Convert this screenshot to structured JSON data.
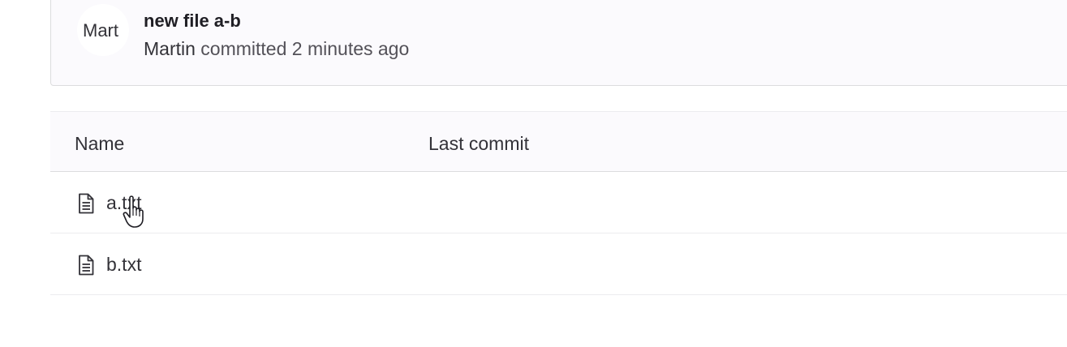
{
  "last_commit": {
    "avatar_text": "Mart",
    "title": "new file a-b",
    "author": "Martin",
    "action": "committed",
    "time": "2 minutes ago"
  },
  "file_table": {
    "columns": [
      "Name",
      "Last commit"
    ],
    "rows": [
      {
        "name": "a.txt",
        "icon": "file-text-icon"
      },
      {
        "name": "b.txt",
        "icon": "file-text-icon"
      }
    ]
  },
  "cursor": {
    "type": "hand-pointer-icon"
  }
}
